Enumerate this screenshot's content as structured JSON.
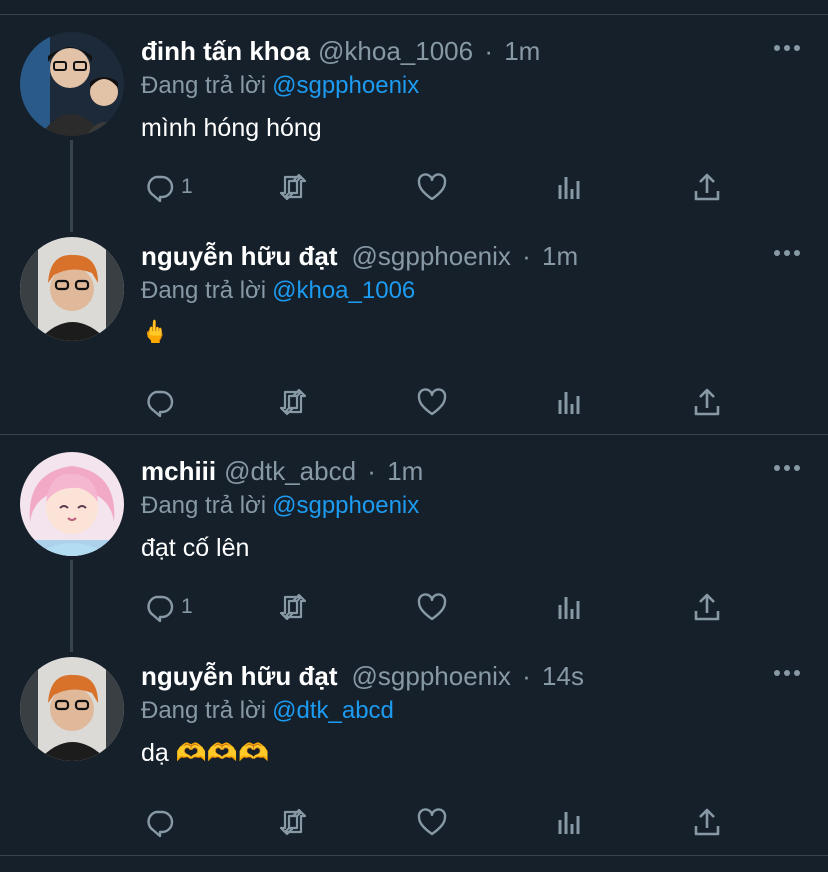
{
  "tweets": [
    {
      "name": "đinh tấn khoa",
      "handle": "@khoa_1006",
      "sep": "·",
      "time": "1m",
      "replying_prefix": "Đang trả lời",
      "replying_to": "@sgpphoenix",
      "text": "mình hóng hóng",
      "reply_count": "1",
      "avatar_icon": "avatar-khoa"
    },
    {
      "name": "nguyễn hữu đạt",
      "handle": "@sgpphoenix",
      "sep": "·",
      "time": "1m",
      "replying_prefix": "Đang trả lời",
      "replying_to": "@khoa_1006",
      "text": "🖕",
      "reply_count": "",
      "avatar_icon": "avatar-dat"
    },
    {
      "name": "mchiii",
      "handle": "@dtk_abcd",
      "sep": "·",
      "time": "1m",
      "replying_prefix": "Đang trả lời",
      "replying_to": "@sgpphoenix",
      "text": "đạt cố lên",
      "reply_count": "1",
      "avatar_icon": "avatar-anime"
    },
    {
      "name": "nguyễn hữu đạt",
      "handle": "@sgpphoenix",
      "sep": "·",
      "time": "14s",
      "replying_prefix": "Đang trả lời",
      "replying_to": "@dtk_abcd",
      "text": "dạ 🫶🫶🫶",
      "reply_count": "",
      "avatar_icon": "avatar-dat"
    }
  ],
  "colors": {
    "background": "#15202b",
    "divider": "#38444d",
    "muted": "#8899a6",
    "mention": "#1d9bf0"
  },
  "icons": [
    "reply-icon",
    "retweet-icon",
    "like-icon",
    "analytics-icon",
    "share-icon",
    "more-icon"
  ]
}
